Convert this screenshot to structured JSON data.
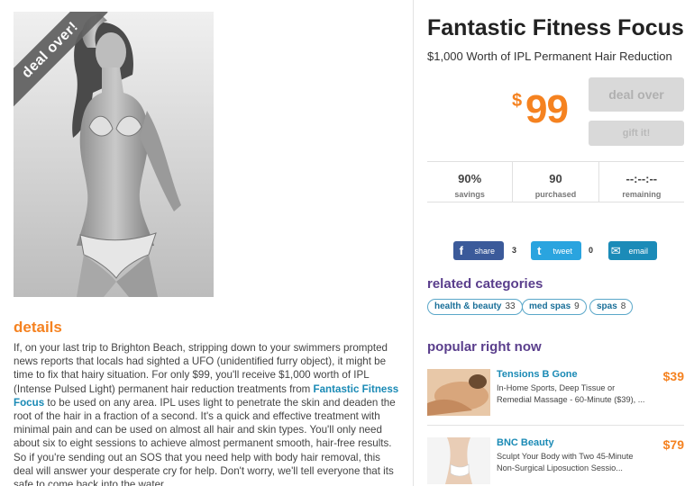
{
  "deal": {
    "ribbon": "deal over!",
    "title": "Fantastic Fitness Focus",
    "subtitle": "$1,000 Worth of IPL Permanent Hair Reduction",
    "price_currency": "$",
    "price_amount": "99",
    "deal_over_label": "deal over",
    "gift_label": "gift it!"
  },
  "stats": [
    {
      "value": "90%",
      "label": "savings"
    },
    {
      "value": "90",
      "label": "purchased"
    },
    {
      "value": "--:--:--",
      "label": "remaining"
    }
  ],
  "share": {
    "facebook": {
      "icon": "f",
      "label": "share",
      "count": "3"
    },
    "twitter": {
      "icon": "t",
      "label": "tweet",
      "count": "0"
    },
    "email": {
      "icon": "✉",
      "label": "email"
    }
  },
  "related": {
    "title": "related categories",
    "tags": [
      {
        "label": "health & beauty",
        "count": "33"
      },
      {
        "label": "med spas",
        "count": "9"
      },
      {
        "label": "spas",
        "count": "8"
      }
    ]
  },
  "popular": {
    "title": "popular right now",
    "items": [
      {
        "name": "Tensions B Gone",
        "price": "$39",
        "desc": "In-Home Sports, Deep Tissue or Remedial Massage - 60-Minute ($39), ..."
      },
      {
        "name": "BNC Beauty",
        "price": "$79",
        "desc": "Sculpt Your Body with Two 45-Minute Non-Surgical Liposuction Sessio..."
      }
    ]
  },
  "details": {
    "title": "details",
    "p1": "If, on your last trip to Brighton Beach, stripping down to your swimmers prompted news reports that locals had sighted a UFO (unidentified furry object), it might be time to fix that hairy situation. For only $99, you'll receive $1,000 worth of IPL (Intense Pulsed Light) permanent hair reduction treatments from ",
    "merchant": "Fantastic Fitness Focus",
    "p2": " to be used on any area. IPL uses light to penetrate the skin and deaden the root of the hair in a fraction of a second. It's a quick and effective treatment with minimal pain and can be used on almost all hair and skin types. You'll only need about six to eight sessions to achieve almost permanent smooth, hair-free results. So if you're sending out an SOS that you need help with body hair removal, this deal will answer your desperate cry for help. Don't worry, we'll tell everyone that its safe to come back into the water."
  },
  "colors": {
    "accent": "#f58220",
    "link": "#1a8ab5",
    "heading": "#5a3e8c"
  }
}
